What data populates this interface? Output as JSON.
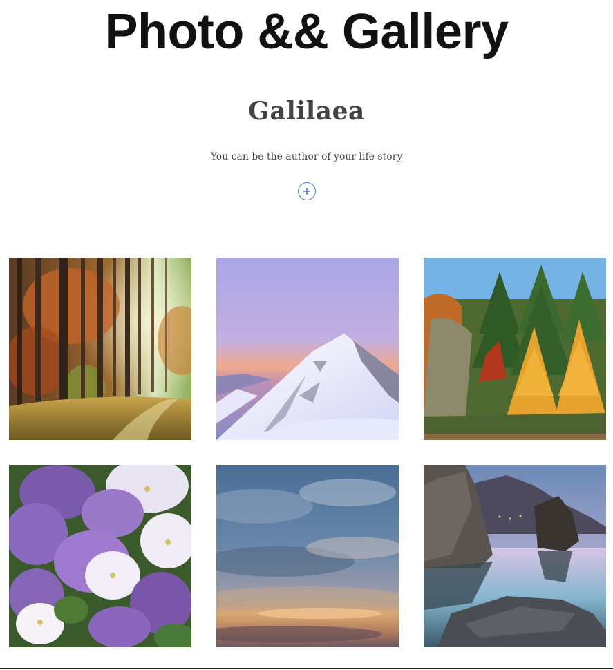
{
  "header": {
    "site_title": "Photo && Gallery",
    "gallery_name": "Galilaea",
    "tagline": "You can be the author of your life story",
    "expand_icon": "plus-circle-icon",
    "accent_color": "#4a7fd4"
  },
  "gallery": {
    "photos": [
      {
        "subject": "autumn-forest-photo"
      },
      {
        "subject": "snowy-mountain-photo"
      },
      {
        "subject": "autumn-trees-photo"
      },
      {
        "subject": "purple-flowers-photo"
      },
      {
        "subject": "sunset-clouds-photo"
      },
      {
        "subject": "lake-rocks-photo"
      }
    ]
  }
}
